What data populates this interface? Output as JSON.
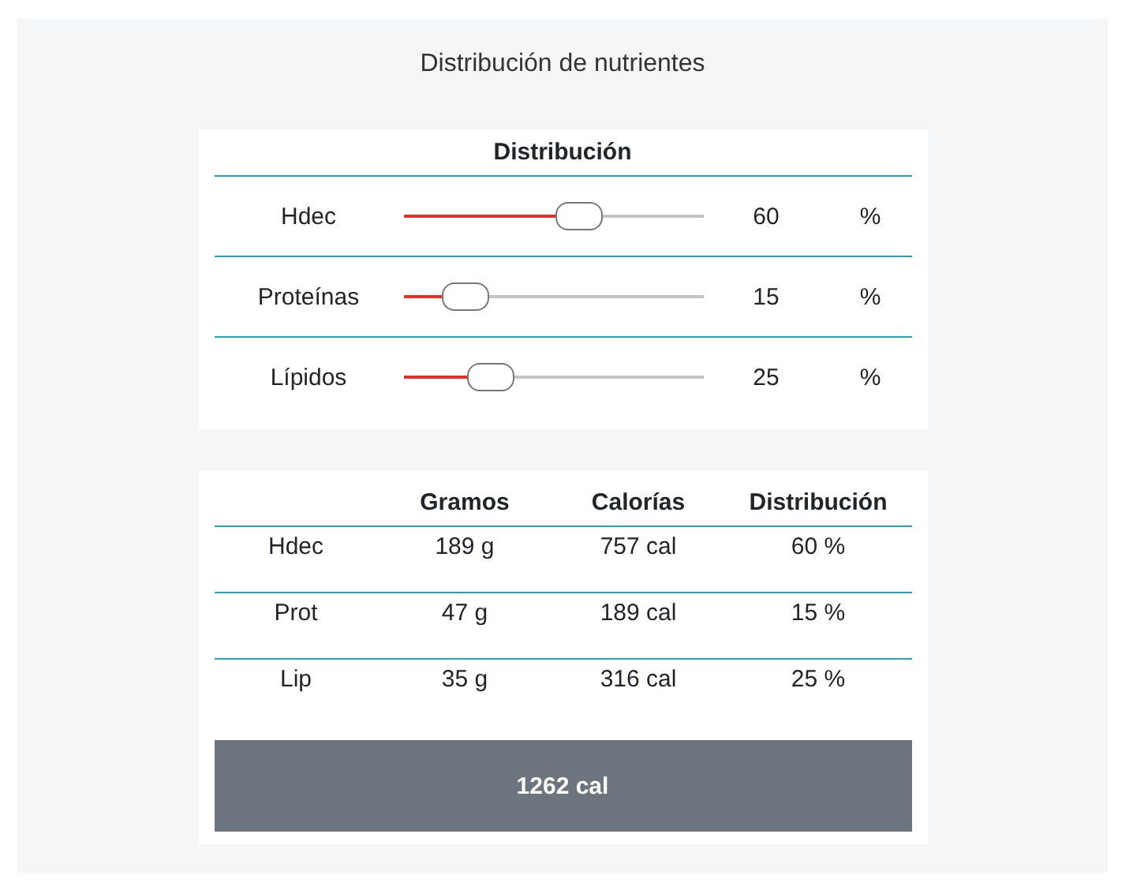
{
  "title": "Distribución de nutrientes",
  "distribution": {
    "heading": "Distribución",
    "rows": [
      {
        "name": "Hdec",
        "level": 0.6,
        "value": "60",
        "unit": "%"
      },
      {
        "name": "Proteínas",
        "level": 0.15,
        "value": "15",
        "unit": "%"
      },
      {
        "name": "Lípidos",
        "level": 0.25,
        "value": "25",
        "unit": "%"
      }
    ]
  },
  "table": {
    "columns": [
      "",
      "Gramos",
      "Calorías",
      "Distribución"
    ],
    "rows": [
      [
        "Hdec",
        "189 g",
        "757 cal",
        "60 %"
      ],
      [
        "Prot",
        "47 g",
        "189 cal",
        "15 %"
      ],
      [
        "Lip",
        "35 g",
        "316 cal",
        "25 %"
      ]
    ],
    "total": "1262 cal"
  }
}
